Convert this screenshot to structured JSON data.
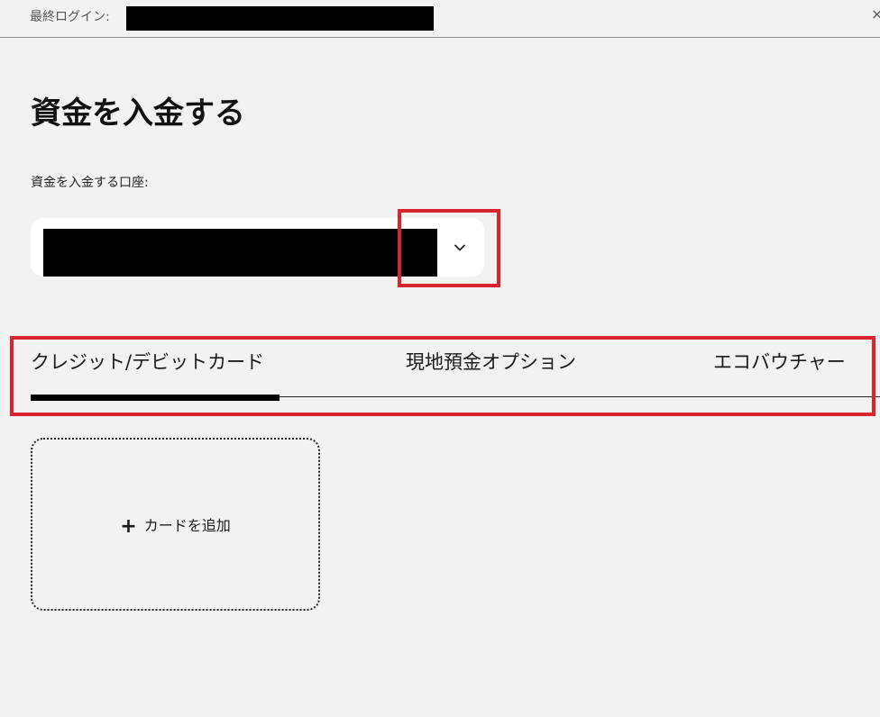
{
  "header": {
    "last_login_label": "最終ログイン:",
    "last_login_value": "",
    "close_glyph": "×"
  },
  "page": {
    "title": "資金を入金する"
  },
  "account": {
    "label": "資金を入金する口座:",
    "selected_value": "",
    "icon": "chevron-down-icon"
  },
  "tabs": [
    {
      "label": "クレジット/デビットカード",
      "active": true
    },
    {
      "label": "現地預金オプション",
      "active": false
    },
    {
      "label": "エコバウチャー",
      "active": false
    }
  ],
  "card": {
    "add_icon": "plus-icon",
    "add_label": "カードを追加"
  },
  "colors": {
    "background": "#f2f2f2",
    "highlight": "#d9232d",
    "redaction": "#000000",
    "select_background": "#ffffff"
  }
}
